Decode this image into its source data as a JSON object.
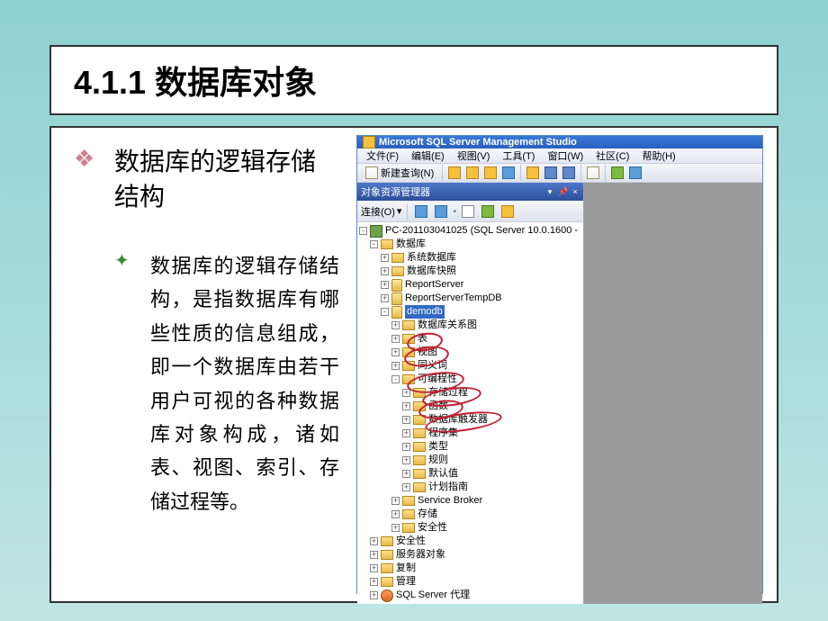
{
  "slide": {
    "section_number": "4.1.1",
    "section_title": "数据库对象",
    "main_heading": "数据库的逻辑存储结构",
    "body_text": "数据库的逻辑存储结构，是指数据库有哪些性质的信息组成，即一个数据库由若干用户可视的各种数据库对象构成，诸如表、视图、索引、存储过程等。"
  },
  "ssms": {
    "title": "Microsoft SQL Server Management Studio",
    "menu": {
      "file": "文件(F)",
      "edit": "编辑(E)",
      "view": "视图(V)",
      "tools": "工具(T)",
      "window": "窗口(W)",
      "community": "社区(C)",
      "help": "帮助(H)"
    },
    "toolbar": {
      "new_query": "新建查询(N)"
    },
    "object_explorer": {
      "title": "对象资源管理器",
      "connect_label": "连接(O)"
    },
    "tree": {
      "server": "PC-201103041025 (SQL Server 10.0.1600 -",
      "databases": "数据库",
      "sys_db": "系统数据库",
      "db_snapshots": "数据库快照",
      "report_server": "ReportServer",
      "report_server_temp": "ReportServerTempDB",
      "demodb": "demodb",
      "db_diagrams": "数据库关系图",
      "tables": "表",
      "views": "视图",
      "synonyms": "同义词",
      "programmability": "可编程性",
      "stored_procs": "存储过程",
      "functions": "函数",
      "db_triggers": "数据库触发器",
      "assemblies": "程序集",
      "types": "类型",
      "rules": "规则",
      "defaults": "默认值",
      "plan_guides": "计划指南",
      "service_broker": "Service Broker",
      "storage": "存储",
      "security_db": "安全性",
      "security": "安全性",
      "server_objects": "服务器对象",
      "replication": "复制",
      "management": "管理",
      "agent": "SQL Server 代理"
    }
  }
}
